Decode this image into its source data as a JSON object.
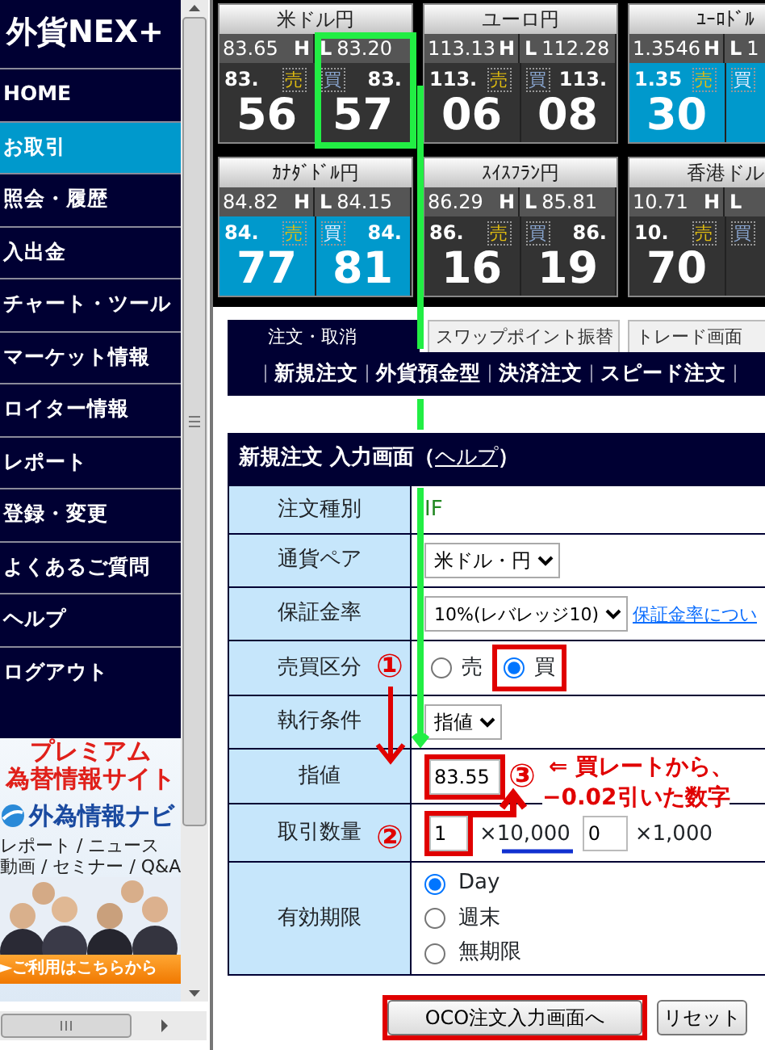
{
  "sidebar": {
    "logo": "外貨NEX+",
    "items": [
      {
        "label": "HOME",
        "selected": false
      },
      {
        "label": "お取引",
        "selected": true
      },
      {
        "label": "照会・履歴",
        "selected": false
      },
      {
        "label": "入出金",
        "selected": false
      },
      {
        "label": "チャート・ツール",
        "selected": false
      },
      {
        "label": "マーケット情報",
        "selected": false
      },
      {
        "label": "ロイター情報",
        "selected": false
      },
      {
        "label": "レポート",
        "selected": false
      },
      {
        "label": "登録・変更",
        "selected": false
      },
      {
        "label": "よくあるご質問",
        "selected": false
      },
      {
        "label": "ヘルプ",
        "selected": false
      },
      {
        "label": "ログアウト",
        "selected": false
      }
    ],
    "banner": {
      "headline": [
        "プレミアム",
        "為替情報サイト"
      ],
      "brand": "外為情報ナビ",
      "lines": [
        "レポート / ニュース",
        "動画 / セミナー / Q&A"
      ],
      "photo": {
        "kind": "picture"
      },
      "cta": "►ご利用はこちらから"
    }
  },
  "rate_tiles": [
    {
      "pair": "米ドル円",
      "high": "83.65",
      "high_label": "H",
      "low_label": "L",
      "low": "83.20",
      "sell": {
        "label": "売",
        "prefix": "83.",
        "pips": "56",
        "highlighted": false
      },
      "buy": {
        "label": "買",
        "prefix": "83.",
        "pips": "57",
        "highlighted": false
      }
    },
    {
      "pair": "ユーロ円",
      "high": "113.13",
      "high_label": "H",
      "low_label": "L",
      "low": "112.28",
      "sell": {
        "label": "売",
        "prefix": "113.",
        "pips": "06",
        "highlighted": false
      },
      "buy": {
        "label": "買",
        "prefix": "113.",
        "pips": "08",
        "highlighted": false
      }
    },
    {
      "pair": "ﾕｰﾛﾄﾞﾙ",
      "high": "1.3546",
      "high_label": "H",
      "low_label": "L",
      "low": "1",
      "sell": {
        "label": "売",
        "prefix": "1.35",
        "pips": "30",
        "highlighted": true
      },
      "buy": {
        "label": "買",
        "highlighted": true
      }
    },
    {
      "pair": "ｶﾅﾀﾞﾄﾞﾙ円",
      "high": "84.82",
      "high_label": "H",
      "low_label": "L",
      "low": "84.15",
      "sell": {
        "label": "売",
        "prefix": "84.",
        "pips": "77",
        "highlighted": true
      },
      "buy": {
        "label": "買",
        "prefix": "84.",
        "pips": "81",
        "highlighted": true
      }
    },
    {
      "pair": "ｽｲｽﾌﾗﾝ円",
      "high": "86.29",
      "high_label": "H",
      "low_label": "L",
      "low": "85.81",
      "sell": {
        "label": "売",
        "prefix": "86.",
        "pips": "16",
        "highlighted": false
      },
      "buy": {
        "label": "買",
        "prefix": "86.",
        "pips": "19",
        "highlighted": false
      }
    },
    {
      "pair": "香港ドル",
      "high": "10.71",
      "high_label": "H",
      "low_label": "L",
      "sell": {
        "label": "売",
        "prefix": "10.",
        "pips": "70",
        "highlighted": false
      },
      "buy": {
        "label": "買",
        "highlighted": false
      }
    }
  ],
  "order_tabs": [
    {
      "label": "注文・取消",
      "selected": true
    },
    {
      "label": "スワップポイント振替",
      "selected": false
    },
    {
      "label": "トレード画面",
      "selected": false
    }
  ],
  "order_menu": [
    {
      "kind": "separator",
      "label": "｜"
    },
    {
      "kind": "link",
      "label": "新規注文"
    },
    {
      "kind": "separator",
      "label": "｜"
    },
    {
      "kind": "link",
      "label": "外貨預金型"
    },
    {
      "kind": "separator",
      "label": "｜"
    },
    {
      "kind": "link",
      "label": "決済注文"
    },
    {
      "kind": "separator",
      "label": "｜"
    },
    {
      "kind": "link",
      "label": "スピード注文"
    },
    {
      "kind": "separator",
      "label": "｜"
    }
  ],
  "form": {
    "title": "新規注文 入力画面（",
    "help_link": "ヘルプ",
    "title_end": "）",
    "rows": [
      {
        "label": "注文種別",
        "kind": "text",
        "value": "IF"
      },
      {
        "label": "通貨ペア",
        "kind": "select",
        "value": "米ドル・円"
      },
      {
        "label": "保証金率",
        "kind": "select",
        "value": "10%(レバレッジ10)",
        "link": "保証金率につい"
      },
      {
        "label": "売買区分",
        "kind": "radios",
        "options": [
          {
            "label": "売",
            "selected": false,
            "annotated": false
          },
          {
            "label": "買",
            "selected": true,
            "annotated": true
          }
        ]
      },
      {
        "label": "執行条件",
        "kind": "select",
        "value": "指値"
      },
      {
        "label": "指値",
        "kind": "input",
        "value": "83.55",
        "annotated": true
      },
      {
        "label": "取引数量",
        "kind": "quantity",
        "fields": [
          {
            "value": "1",
            "unit": "×10,000",
            "annotated": true
          },
          {
            "value": "0",
            "unit": "×1,000",
            "annotated": false
          }
        ]
      },
      {
        "label": "有効期限",
        "kind": "radio_list",
        "options": [
          {
            "label": "Day",
            "selected": true
          },
          {
            "label": "週末",
            "selected": false
          },
          {
            "label": "無期限",
            "selected": false
          }
        ]
      }
    ],
    "buttons": [
      {
        "label": "OCO注文入力画面へ",
        "annotated": true
      },
      {
        "label": "リセット",
        "annotated": false
      }
    ]
  },
  "annotations": {
    "marks": [
      "①",
      "②",
      "③"
    ],
    "note": [
      "⇐ 買レートから、",
      "−0.02引いた数字"
    ]
  }
}
